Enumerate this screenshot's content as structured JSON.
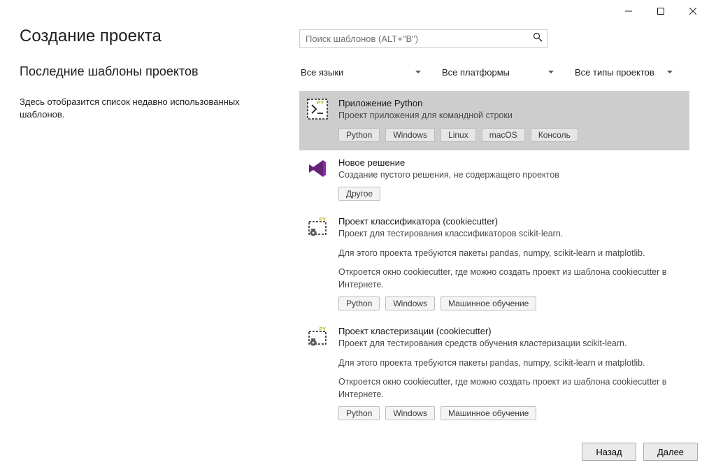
{
  "window": {
    "title": "Создание проекта",
    "recent_title": "Последние шаблоны проектов",
    "recent_empty": "Здесь отобразится список недавно использованных шаблонов."
  },
  "search": {
    "placeholder": "Поиск шаблонов (ALT+\"В\")"
  },
  "filters": {
    "language": "Все языки",
    "platform": "Все платформы",
    "project_type": "Все типы проектов"
  },
  "templates": [
    {
      "icon": "python-app",
      "title": "Приложение Python",
      "desc": "Проект приложения для командной строки",
      "paras": [],
      "tags": [
        "Python",
        "Windows",
        "Linux",
        "macOS",
        "Консоль"
      ],
      "selected": true
    },
    {
      "icon": "vs-solution",
      "title": "Новое решение",
      "desc": "Создание пустого решения, не содержащего проектов",
      "paras": [],
      "tags": [
        "Другое"
      ],
      "selected": false
    },
    {
      "icon": "python-cookiecutter",
      "title": "Проект классификатора (cookiecutter)",
      "desc": "Проект для тестирования классификаторов scikit-learn.",
      "paras": [
        "Для этого проекта требуются пакеты pandas, numpy, scikit-learn и matplotlib.",
        "Откроется окно cookiecutter, где можно создать проект из шаблона cookiecutter в Интернете."
      ],
      "tags": [
        "Python",
        "Windows",
        "Машинное обучение"
      ],
      "selected": false
    },
    {
      "icon": "python-cookiecutter",
      "title": "Проект кластеризации (cookiecutter)",
      "desc": "Проект для тестирования средств обучения кластеризации scikit-learn.",
      "paras": [
        "Для этого проекта требуются пакеты pandas, numpy, scikit-learn и matplotlib.",
        "Откроется окно cookiecutter, где можно создать проект из шаблона cookiecutter в Интернете."
      ],
      "tags": [
        "Python",
        "Windows",
        "Машинное обучение"
      ],
      "selected": false
    }
  ],
  "buttons": {
    "back": "Назад",
    "next": "Далее"
  }
}
